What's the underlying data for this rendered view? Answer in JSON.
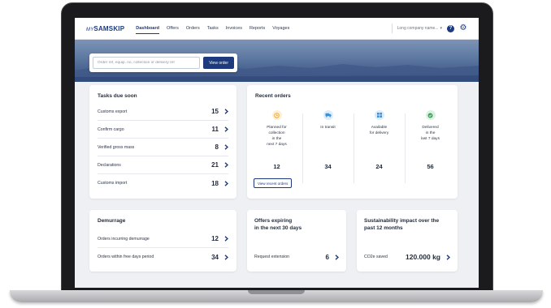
{
  "brand": {
    "prefix": "MY",
    "name": "SAMSKIP"
  },
  "nav": {
    "items": [
      {
        "label": "Dashboard",
        "active": true
      },
      {
        "label": "Offers",
        "active": false
      },
      {
        "label": "Orders",
        "active": false
      },
      {
        "label": "Tasks",
        "active": false
      },
      {
        "label": "Invoices",
        "active": false
      },
      {
        "label": "Reports",
        "active": false
      },
      {
        "label": "Voyages",
        "active": false
      }
    ],
    "company": "Long company name...",
    "help_glyph": "?",
    "icons": [
      "help-icon",
      "gear-icon",
      "chevron-down-icon"
    ]
  },
  "search": {
    "placeholder": "Order ref, equip. no, collection or delivery ref",
    "value": "",
    "button_label": "View order"
  },
  "tasks": {
    "title": "Tasks due soon",
    "rows": [
      {
        "label": "Customs export",
        "count": "15"
      },
      {
        "label": "Confirm cargo",
        "count": "11"
      },
      {
        "label": "Verified gross mass",
        "count": "8"
      },
      {
        "label": "Declarations",
        "count": "21"
      },
      {
        "label": "Customs import",
        "count": "18"
      }
    ]
  },
  "recent_orders": {
    "title": "Recent orders",
    "columns": [
      {
        "label": "Planned for\ncollection\nin the\nnext 7 days",
        "count": "12",
        "icon": "clock-icon",
        "color": "#f0a32a",
        "bg": "#fdf0d9"
      },
      {
        "label": "In transit",
        "count": "34",
        "icon": "truck-icon",
        "color": "#3b8fd6",
        "bg": "#dcecf9"
      },
      {
        "label": "Available\nfor delivery",
        "count": "24",
        "icon": "grid-icon",
        "color": "#3b8fd6",
        "bg": "#dcecf9"
      },
      {
        "label": "Delivered\nin the\nlast 7 days",
        "count": "56",
        "icon": "check-icon",
        "color": "#3aa35b",
        "bg": "#dcf1e2"
      }
    ],
    "button_label": "View recent orders"
  },
  "demurrage": {
    "title": "Demurrage",
    "rows": [
      {
        "label": "Orders incurring demurrage",
        "count": "12"
      },
      {
        "label": "Orders within free days period",
        "count": "34"
      }
    ]
  },
  "offers_expiring": {
    "title_line1": "Offers expiring",
    "title_line2": "in the next 30 days",
    "row_label": "Request extension",
    "row_count": "6"
  },
  "sustainability": {
    "title_line1": "Sustainability impact over the",
    "title_line2": "past 12 months",
    "row_label": "CO2e saved",
    "row_value": "120.000 kg"
  },
  "colors": {
    "primary": "#1c3a7d",
    "background": "#eef0f4"
  }
}
